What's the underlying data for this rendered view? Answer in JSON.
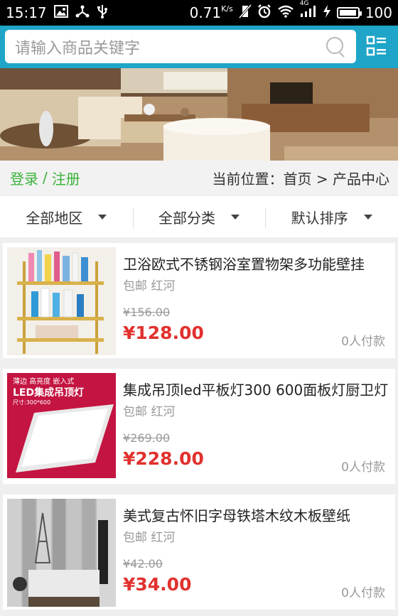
{
  "status_bar": {
    "time": "15:17",
    "speed": "0.71",
    "speed_unit": "K/s",
    "network": "4G",
    "battery_text": "100",
    "battery_level": 0.95
  },
  "search": {
    "placeholder": "请输入商品关键字"
  },
  "breadcrumb_bar": {
    "login": "登录",
    "separator": "/",
    "register": "注册",
    "location": "当前位置：首页 > 产品中心"
  },
  "filters": [
    {
      "label": "全部地区"
    },
    {
      "label": "全部分类"
    },
    {
      "label": "默认排序"
    }
  ],
  "products": [
    {
      "title": "卫浴欧式不锈钢浴室置物架多功能壁挂",
      "tag": "包邮 红河",
      "old_price": "¥156.00",
      "price": "¥128.00",
      "sold": "0人付款",
      "image": "bathroom-shelf"
    },
    {
      "title": "集成吊顶led平板灯300 600面板灯厨卫灯",
      "tag": "包邮 红河",
      "old_price": "¥269.00",
      "price": "¥228.00",
      "sold": "0人付款",
      "image": "led-panel-light",
      "image_text_1": "薄边 高亮度 嵌入式",
      "image_text_2": "LED集成吊顶灯",
      "image_text_3": "尺寸:300*600"
    },
    {
      "title": "美式复古怀旧字母铁塔木纹木板壁纸",
      "tag": "包邮 红河",
      "old_price": "¥42.00",
      "price": "¥34.00",
      "sold": "0人付款",
      "image": "wallpaper"
    }
  ],
  "colors": {
    "header": "#1fa5c8",
    "login": "#3bb23b",
    "price": "#e1312e"
  }
}
